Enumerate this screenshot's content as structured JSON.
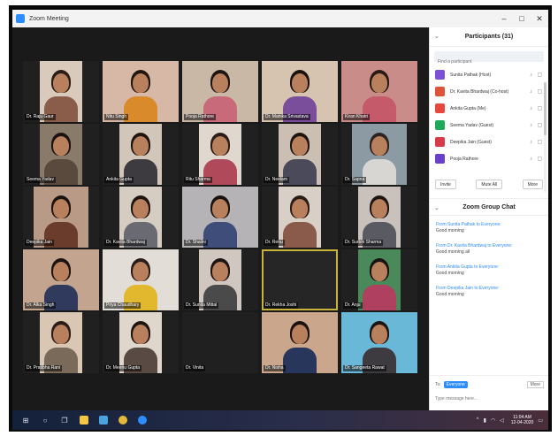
{
  "window": {
    "title": "Zoom Meeting",
    "minimize": "–",
    "maximize": "□",
    "close": "✕"
  },
  "accent": "#2d8cff",
  "active_speaker_color": "#c9b43a",
  "tiles": [
    {
      "name": "Dr. Raju Gaur",
      "cam": true,
      "size": "n",
      "bg": "#d9cabb",
      "hair": "#2a1c16",
      "shirt": "#8a5c4a"
    },
    {
      "name": "Nitu Singh",
      "cam": true,
      "size": "w",
      "bg": "#d7b7a6",
      "hair": "#221510",
      "shirt": "#d98b2c"
    },
    {
      "name": "Pooja Rathore",
      "cam": true,
      "size": "w",
      "bg": "#c9b8a6",
      "hair": "#1e1512",
      "shirt": "#c96a7a"
    },
    {
      "name": "Dr. Mahika Srivastava",
      "cam": true,
      "size": "w",
      "bg": "#d6c3b0",
      "hair": "#1b1210",
      "shirt": "#7a4e9a"
    },
    {
      "name": "Kiran Khatri",
      "cam": true,
      "size": "w",
      "bg": "#c98c88",
      "hair": "#2a1a15",
      "shirt": "#c55a6a"
    },
    {
      "name": "Seema Yadav",
      "cam": true,
      "size": "n",
      "bg": "#8a7a6a",
      "hair": "#1a1210",
      "shirt": "#5a4a3e"
    },
    {
      "name": "Ankita Gupta",
      "cam": true,
      "size": "n",
      "bg": "#d2c6bb",
      "hair": "#1e1512",
      "shirt": "#3d3a40"
    },
    {
      "name": "Ritu Sharma",
      "cam": true,
      "size": "n",
      "bg": "#e0d8cf",
      "hair": "#2a1c16",
      "shirt": "#b04a5a"
    },
    {
      "name": "Dr. Neelam",
      "cam": true,
      "size": "n",
      "bg": "#cbbfb4",
      "hair": "#1e1512",
      "shirt": "#4a4a5a"
    },
    {
      "name": "Dr. Sapna",
      "cam": true,
      "size": "m",
      "bg": "#8c9aa3",
      "hair": "#2d2320",
      "shirt": "#d8d6d2"
    },
    {
      "name": "Deepika Jain",
      "cam": true,
      "size": "m",
      "bg": "#b89a86",
      "hair": "#1b1210",
      "shirt": "#6a3c2c"
    },
    {
      "name": "Dr. Kavita Bhardwaj",
      "cam": true,
      "size": "n",
      "bg": "#d6cdc2",
      "hair": "#1e1512",
      "shirt": "#6a6a72"
    },
    {
      "name": "Dr. Shalini",
      "cam": true,
      "size": "w",
      "bg": "#b6b3b6",
      "hair": "#1a1210",
      "shirt": "#3e4d7a"
    },
    {
      "name": "Dr. Renu",
      "cam": true,
      "size": "n",
      "bg": "#d8cfc6",
      "hair": "#2a1c16",
      "shirt": "#8a5a4a"
    },
    {
      "name": "Dr. Surbhi Sharma",
      "cam": true,
      "size": "n",
      "bg": "#c9c2bc",
      "hair": "#1e1512",
      "shirt": "#5a5a62"
    },
    {
      "name": "Dr. Alka Singh",
      "cam": true,
      "size": "w",
      "bg": "#c3a48e",
      "hair": "#1b1210",
      "shirt": "#2f3a5c"
    },
    {
      "name": "Priya Chaudhary",
      "cam": true,
      "size": "w",
      "bg": "#e2ddd6",
      "hair": "#2a1c16",
      "shirt": "#e1b82e"
    },
    {
      "name": "Dr. Sunita Mittal",
      "cam": true,
      "size": "n",
      "bg": "#d0c8c0",
      "hair": "#1e1512",
      "shirt": "#4a4a4a"
    },
    {
      "name": "Dr. Rekha Joshi",
      "cam": false,
      "active": true
    },
    {
      "name": "Dr. Anju",
      "cam": true,
      "size": "n",
      "bg": "#4a8a5a",
      "hair": "#1a1210",
      "shirt": "#b04060"
    },
    {
      "name": "Dr. Pratibha Rani",
      "cam": true,
      "size": "n",
      "bg": "#d9c7b3",
      "hair": "#2a1c16",
      "shirt": "#7a6a5a"
    },
    {
      "name": "Dr. Meenu Gupta",
      "cam": true,
      "size": "n",
      "bg": "#e0d7cc",
      "hair": "#1e1512",
      "shirt": "#5a4a44"
    },
    {
      "name": "Dr. Vinita",
      "cam": false
    },
    {
      "name": "Dr. Nisha",
      "cam": true,
      "size": "w",
      "bg": "#c9a68c",
      "hair": "#1b1210",
      "shirt": "#27365a"
    },
    {
      "name": "Dr. Sangeeta Rawat",
      "cam": true,
      "size": "w",
      "bg": "#6ab8d8",
      "hair": "#1e1512",
      "shirt": "#3d3a40"
    }
  ],
  "participants": {
    "title": "Participants (31)",
    "search_placeholder": "Find a participant",
    "list": [
      {
        "name": "Sunita Pathak (Host)",
        "initial": "S",
        "color": "#7b4fd6"
      },
      {
        "name": "Dr. Kavita Bhardwaj (Co-host)",
        "initial": "D",
        "color": "#e0533b"
      },
      {
        "name": "Ankita Gupta (Me)",
        "initial": "A",
        "color": "#e8483c"
      },
      {
        "name": "Seema Yadav (Guest)",
        "initial": "S",
        "color": "#1ea85a"
      },
      {
        "name": "Deepika Jain (Guest)",
        "initial": "D",
        "color": "#d93a4a"
      },
      {
        "name": "Pooja Rathore",
        "initial": "P",
        "color": "#6a3fc9"
      }
    ],
    "buttons": [
      "Invite",
      "Mute All",
      "More"
    ]
  },
  "chat": {
    "title": "Zoom Group Chat",
    "messages": [
      {
        "from": "From Sunita Pathak to Everyone:",
        "text": "Good morning"
      },
      {
        "from": "From Dr. Kavita Bhardwaj to Everyone:",
        "text": "Good morning all"
      },
      {
        "from": "From Ankita Gupta to Everyone:",
        "text": "Good morning"
      },
      {
        "from": "From Deepika Jain to Everyone:",
        "text": "Good morning"
      }
    ],
    "to_label": "To:",
    "to_value": "Everyone",
    "more_label": "More",
    "input_placeholder": "Type message here..."
  },
  "taskbar": {
    "start": "⊞",
    "search": "○",
    "taskview": "❐",
    "clock_time": "11:04 AM",
    "clock_date": "12-04-2020"
  }
}
